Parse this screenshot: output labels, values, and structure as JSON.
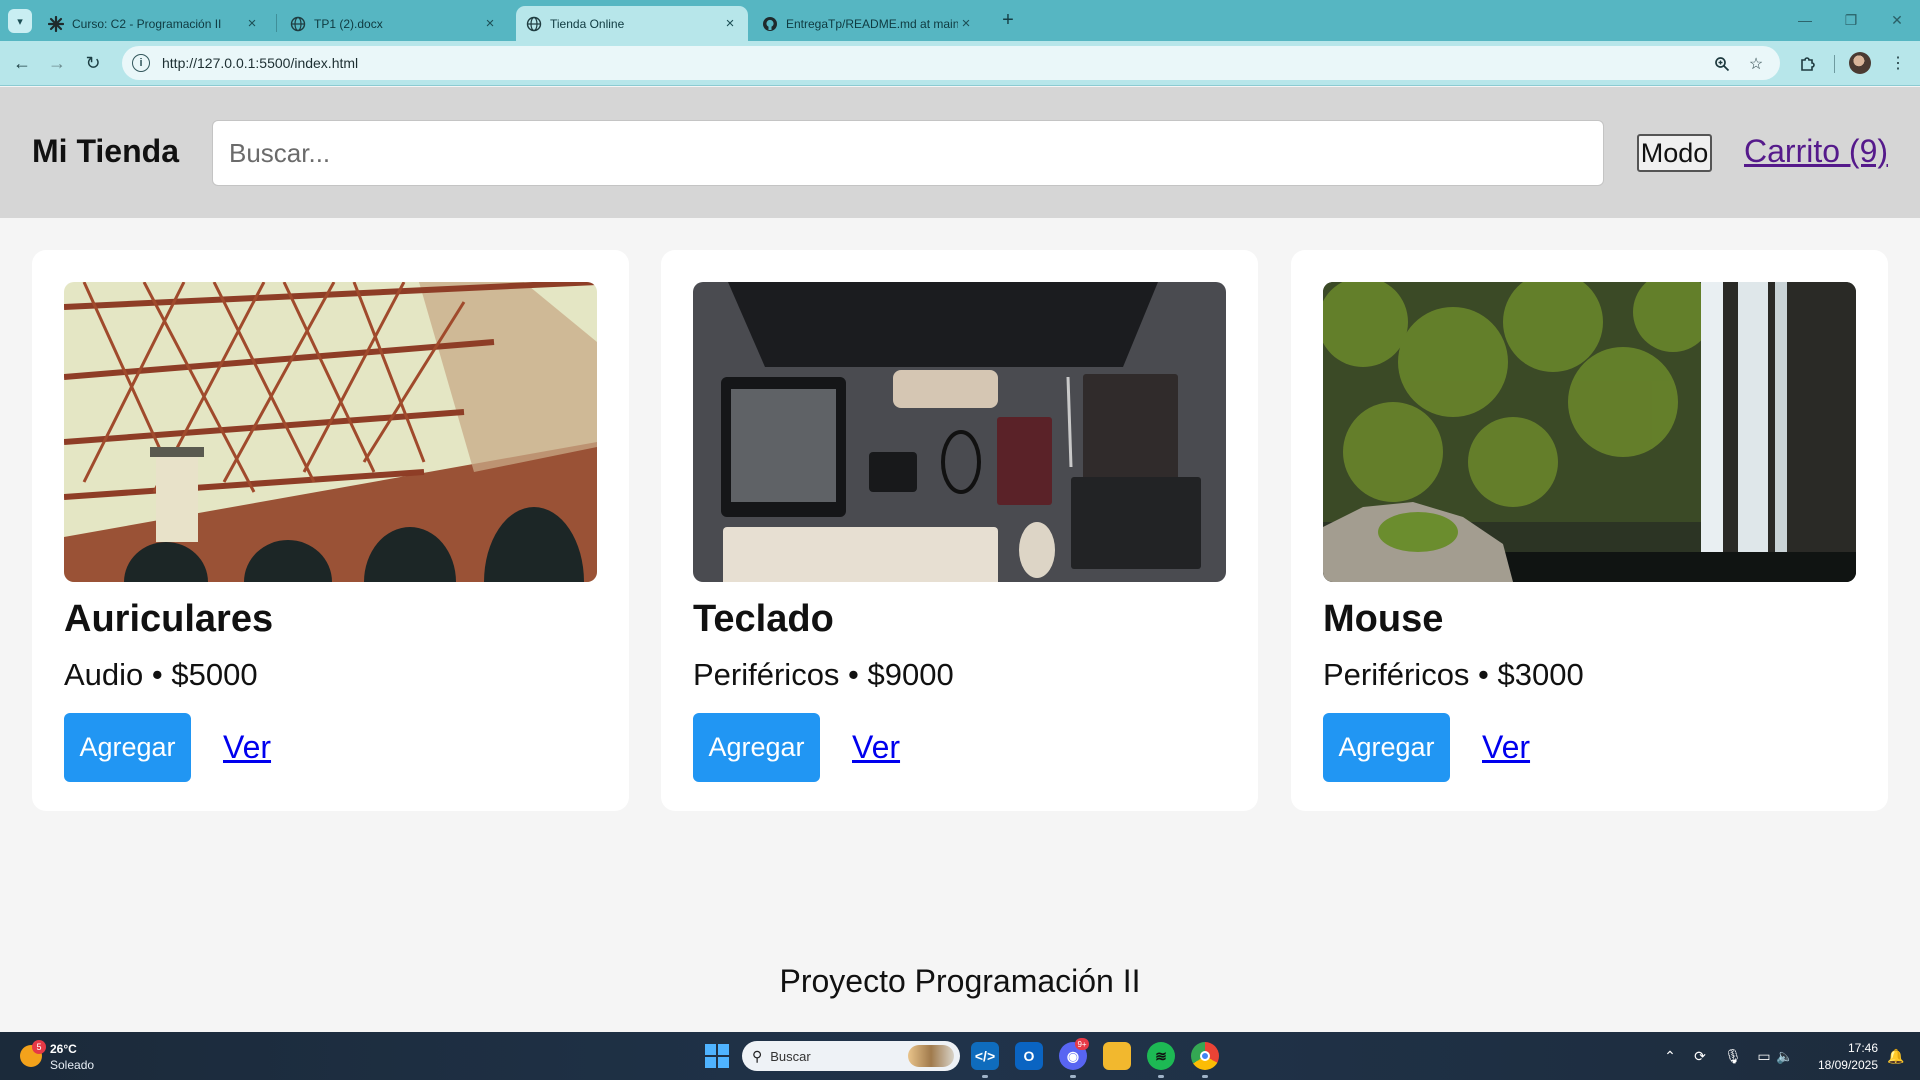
{
  "browser": {
    "tabs": [
      {
        "title": "Curso: C2 - Programación II",
        "active": false
      },
      {
        "title": "TP1 (2).docx",
        "active": false
      },
      {
        "title": "Tienda Online",
        "active": true
      },
      {
        "title": "EntregaTp/README.md at main",
        "active": false
      }
    ],
    "url": "http://127.0.0.1:5500/index.html",
    "accent_color": "#56b6c2"
  },
  "site": {
    "brand": "Mi Tienda",
    "search_placeholder": "Buscar...",
    "mode_button": "Modo",
    "cart_link": "Carrito (9)",
    "add_label": "Agregar",
    "view_label": "Ver",
    "button_color": "#2196f3",
    "products": [
      {
        "name": "Auriculares",
        "category": "Audio",
        "price": "$5000",
        "meta": "Audio • $5000"
      },
      {
        "name": "Teclado",
        "category": "Periféricos",
        "price": "$9000",
        "meta": "Periféricos • $9000"
      },
      {
        "name": "Mouse",
        "category": "Periféricos",
        "price": "$3000",
        "meta": "Periféricos • $3000"
      }
    ],
    "footer": "Proyecto Programación II"
  },
  "taskbar": {
    "weather_badge": "5",
    "weather_temp": "26°C",
    "weather_desc": "Soleado",
    "search_label": "Buscar",
    "discord_badge": "9+",
    "time": "17:46",
    "date": "18/09/2025"
  }
}
